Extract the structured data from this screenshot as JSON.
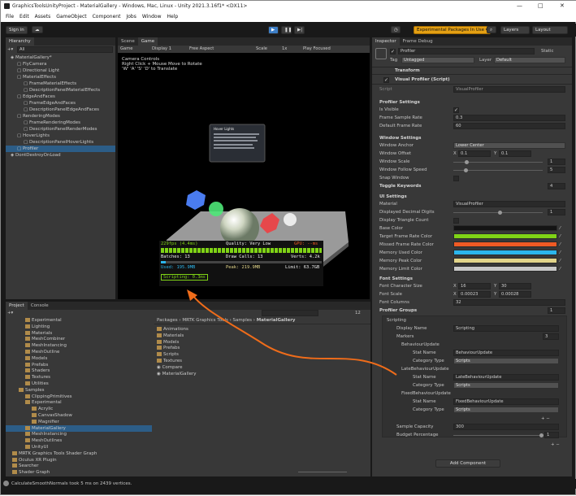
{
  "window": {
    "title": "GraphicsToolsUnityProject - MaterialGallery - Windows, Mac, Linux - Unity 2021.3.16f1* <DX11>",
    "controls": [
      "—",
      "□",
      "✕"
    ]
  },
  "menu": [
    "File",
    "Edit",
    "Assets",
    "GameObject",
    "Component",
    "Jobs",
    "Window",
    "Help"
  ],
  "toolbar": {
    "signin": "Sign in",
    "exp": "Experimental Packages In Use ▾",
    "layers": "Layers",
    "layout": "Layout"
  },
  "hierarchy": {
    "tab": "Hierarchy",
    "search": "All",
    "items": [
      "MaterialGallery*",
      "FlyCamera",
      "Directional Light",
      "MaterialEffects",
      "FrameMaterialEffects",
      "DescriptionPanelMaterialEffects",
      "EdgeAndFaces",
      "FrameEdgeAndFaces",
      "DescriptionPanelEdgeAndFaces",
      "RenderingModes",
      "FrameRenderingModes",
      "DescriptionPanelRenderModes",
      "HoverLights",
      "DescriptionPanelHoverLights",
      "Profiler",
      "DontDestroyOnLoad"
    ]
  },
  "game": {
    "tabs": [
      "Scene",
      "Game"
    ],
    "bar": [
      "Game",
      "Display 1",
      "Free Aspect",
      "Scale",
      "1x",
      "Play Focused"
    ],
    "controls": [
      "Camera Controls",
      "Right Click + Mouse Move to Rotate",
      "'W' 'A' 'S' 'D' to Translate"
    ],
    "hover_title": "Hover Lights"
  },
  "profiler": {
    "fps": "229fps (4.4ms)",
    "quality": "Quality: Very Low",
    "gpu": "GPU: --ms",
    "batches": "Batches: 13",
    "draw": "Draw Calls: 13",
    "verts": "Verts: 4.2k",
    "used": "Used: 195.9MB",
    "peak": "Peak: 219.9MB",
    "limit": "Limit: 63.7GB",
    "scripting": "Scripting: 0.3ms"
  },
  "project": {
    "tabs": [
      "Project",
      "Console"
    ],
    "tree": [
      "Experimental",
      "Lighting",
      "Materials",
      "MeshCombiner",
      "MeshInstancing",
      "MeshOutline",
      "Models",
      "Prefabs",
      "Shaders",
      "Textures",
      "Utilities",
      "Samples",
      "ClippingPrimitives",
      "Experimental",
      "Acrylic",
      "CanvasShadow",
      "Magnifier",
      "MaterialGallery",
      "MeshInstancing",
      "MeshOutlines",
      "UnityUI",
      "MRTK Graphics Tools Shader Graph",
      "Oculus XR Plugin",
      "Searcher",
      "Shader Graph"
    ],
    "breadcrumb": [
      "Packages",
      "MRTK Graphics Tools",
      "Samples",
      "MaterialGallery"
    ],
    "files": [
      "Animations",
      "Materials",
      "Models",
      "Prefabs",
      "Scripts",
      "Textures",
      "Compare",
      "MaterialGallery"
    ],
    "count": "12"
  },
  "status": "CalculateSmoothNormals took 5 ms on 2439 vertices.",
  "inspector": {
    "tabs": [
      "Inspector",
      "Frame Debug"
    ],
    "name": "Profiler",
    "static": "Static",
    "tag_label": "Tag",
    "tag": "Untagged",
    "layer_label": "Layer",
    "layer": "Default",
    "transform": "Transform",
    "component": "Visual Profiler (Script)",
    "script_label": "Script",
    "script": "VisualProfiler",
    "sections": {
      "ps": "Profiler Settings",
      "ws": "Window Settings",
      "tk": "Toggle Keywords",
      "ui": "UI Settings",
      "fs": "Font Settings",
      "pg": "Profiler Groups"
    },
    "is_visible": "Is Visible",
    "fsr": "Frame Sample Rate",
    "fsr_v": "0.3",
    "dfr": "Default Frame Rate",
    "dfr_v": "60",
    "wa": "Window Anchor",
    "wa_v": "Lower Center",
    "wo": "Window Offset",
    "wo_x": "0.1",
    "wo_y": "0.1",
    "wsc": "Window Scale",
    "wsc_v": "1",
    "wfs": "Window Follow Speed",
    "wfs_v": "5",
    "sw": "Snap Window",
    "tk_v": "4",
    "mat": "Material",
    "mat_v": "VisualProfiler",
    "ddd": "Displayed Decimal Digits",
    "ddd_v": "1",
    "dtc": "Display Triangle Count",
    "colors": [
      {
        "l": "Base Color",
        "c": "#141414"
      },
      {
        "l": "Target Frame Rate Color",
        "c": "#7fd316"
      },
      {
        "l": "Missed Frame Rate Color",
        "c": "#f05a24"
      },
      {
        "l": "Memory Used Color",
        "c": "#2cb6ec"
      },
      {
        "l": "Memory Peak Color",
        "c": "#e1d48a"
      },
      {
        "l": "Memory Limit Color",
        "c": "#c8c8c8"
      }
    ],
    "fcs": "Font Character Size",
    "fcs_x": "16",
    "fcs_y": "30",
    "fsc": "Font Scale",
    "fsc_x": "0.00023",
    "fsc_y": "0.00028",
    "fcol": "Font Columns",
    "fcol_v": "32",
    "pg_v": "1",
    "scripting": "Scripting",
    "dn": "Display Name",
    "dn_v": "Scripting",
    "markers": "Markers",
    "markers_v": "3",
    "marker_list": [
      {
        "h": "BehaviourUpdate",
        "sn": "BehaviourUpdate",
        "ct": "Scripts"
      },
      {
        "h": "LateBehaviourUpdate",
        "sn": "LateBehaviourUpdate",
        "ct": "Scripts"
      },
      {
        "h": "FixedBehaviourUpdate",
        "sn": "FixedBehaviourUpdate",
        "ct": "Scripts"
      }
    ],
    "sn": "Stat Name",
    "ct": "Category Type",
    "sc": "Sample Capacity",
    "sc_v": "300",
    "bp": "Budget Percentage",
    "bp_v": "1",
    "add": "Add Component"
  }
}
